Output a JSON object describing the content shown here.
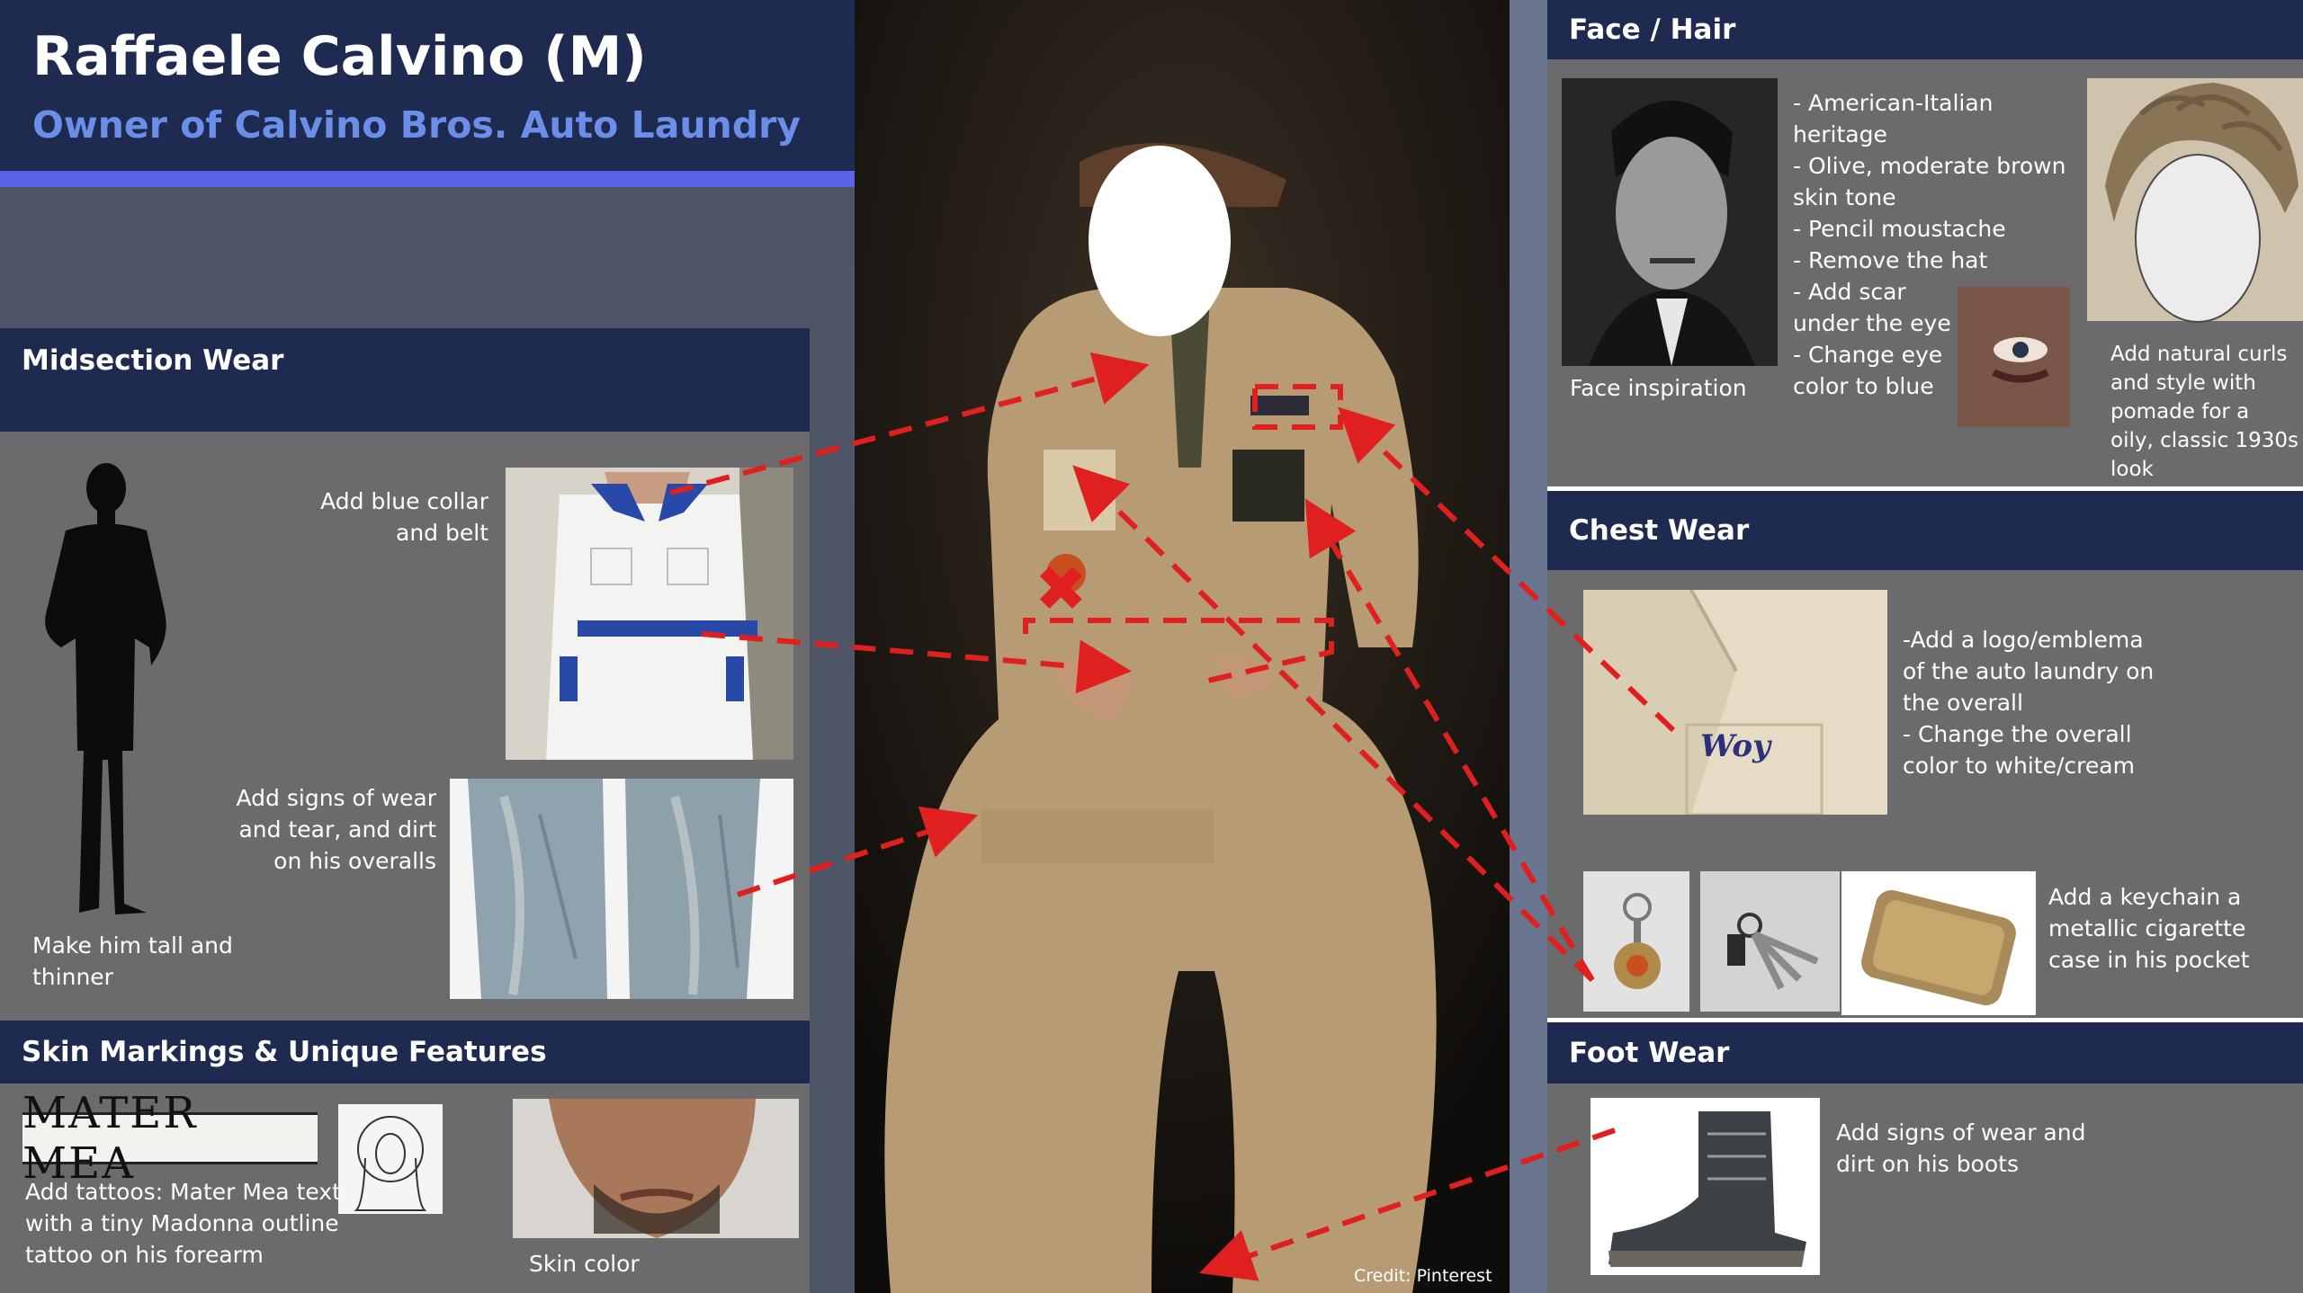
{
  "header": {
    "title": "Raffaele Calvino (M)",
    "subtitle": "Owner of Calvino Bros. Auto Laundry"
  },
  "center": {
    "credit": "Credit: Pinterest"
  },
  "midsection": {
    "heading": "Midsection Wear",
    "collar_note": [
      "Add blue collar",
      "and belt"
    ],
    "wear_note": [
      "Add signs of wear",
      "and tear, and dirt",
      "on his overalls"
    ],
    "tall_note": [
      "Make him tall  and",
      "thinner"
    ]
  },
  "skin": {
    "heading": "Skin Markings & Unique Features",
    "tattoo_text": "MATER MEA",
    "tattoo_note": [
      "Add tattoos: Mater Mea text",
      "with a tiny Madonna outline",
      "tattoo on his forearm"
    ],
    "skin_label": "Skin color"
  },
  "face": {
    "heading": "Face / Hair",
    "inspiration_label": "Face inspiration",
    "notes": [
      "- American-Italian",
      "heritage",
      "- Olive, moderate brown",
      "skin tone",
      "- Pencil moustache",
      "- Remove the hat",
      "- Add scar",
      "under the eye",
      "- Change eye",
      "color to blue"
    ],
    "hair_note": [
      "Add natural curls",
      "and style with",
      "pomade for a",
      "oily, classic 1930s",
      "look"
    ]
  },
  "chest": {
    "heading": "Chest Wear",
    "notes": [
      "-Add a logo/emblema",
      "of the auto laundry on",
      "the overall",
      "- Change the overall",
      "color to white/cream"
    ],
    "emblem_text": "Woy",
    "keychain_note": [
      "Add a keychain a",
      "metallic cigarette",
      "case in his pocket"
    ]
  },
  "foot": {
    "heading": "Foot Wear",
    "notes": [
      "Add signs of wear and",
      "dirt on his boots"
    ]
  },
  "colors": {
    "navy": "#1e2a4f",
    "accent_blue": "#5b63e8",
    "subtitle_blue": "#6b8fe8",
    "arrow_red": "#e0201e",
    "panel_grey": "#6b6b6d"
  }
}
